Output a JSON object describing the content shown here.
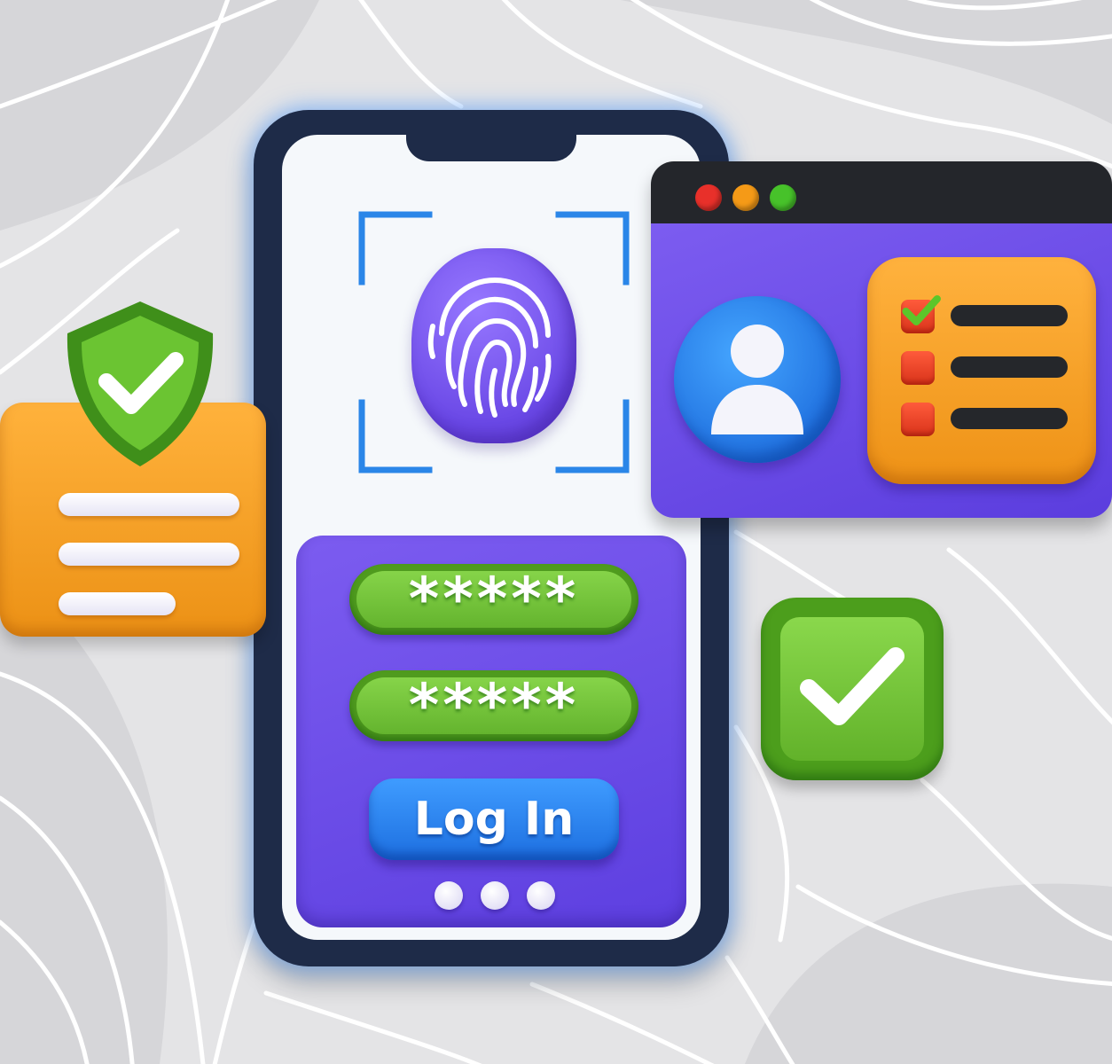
{
  "login": {
    "password_field_1": "*****",
    "password_field_2": "*****",
    "login_button_label": "Log In"
  },
  "icons": {
    "fingerprint": "fingerprint-icon",
    "user": "user-icon",
    "shield": "shield-check-icon",
    "checkmark": "check-icon"
  },
  "colors": {
    "phone_frame": "#1e2b48",
    "panel_purple": "#6a4be6",
    "accent_green": "#6bbc32",
    "accent_orange": "#f5a02a",
    "button_blue": "#2d86f0",
    "traffic_red": "#e8302a",
    "traffic_orange": "#f59a17",
    "traffic_green": "#47c22a"
  }
}
